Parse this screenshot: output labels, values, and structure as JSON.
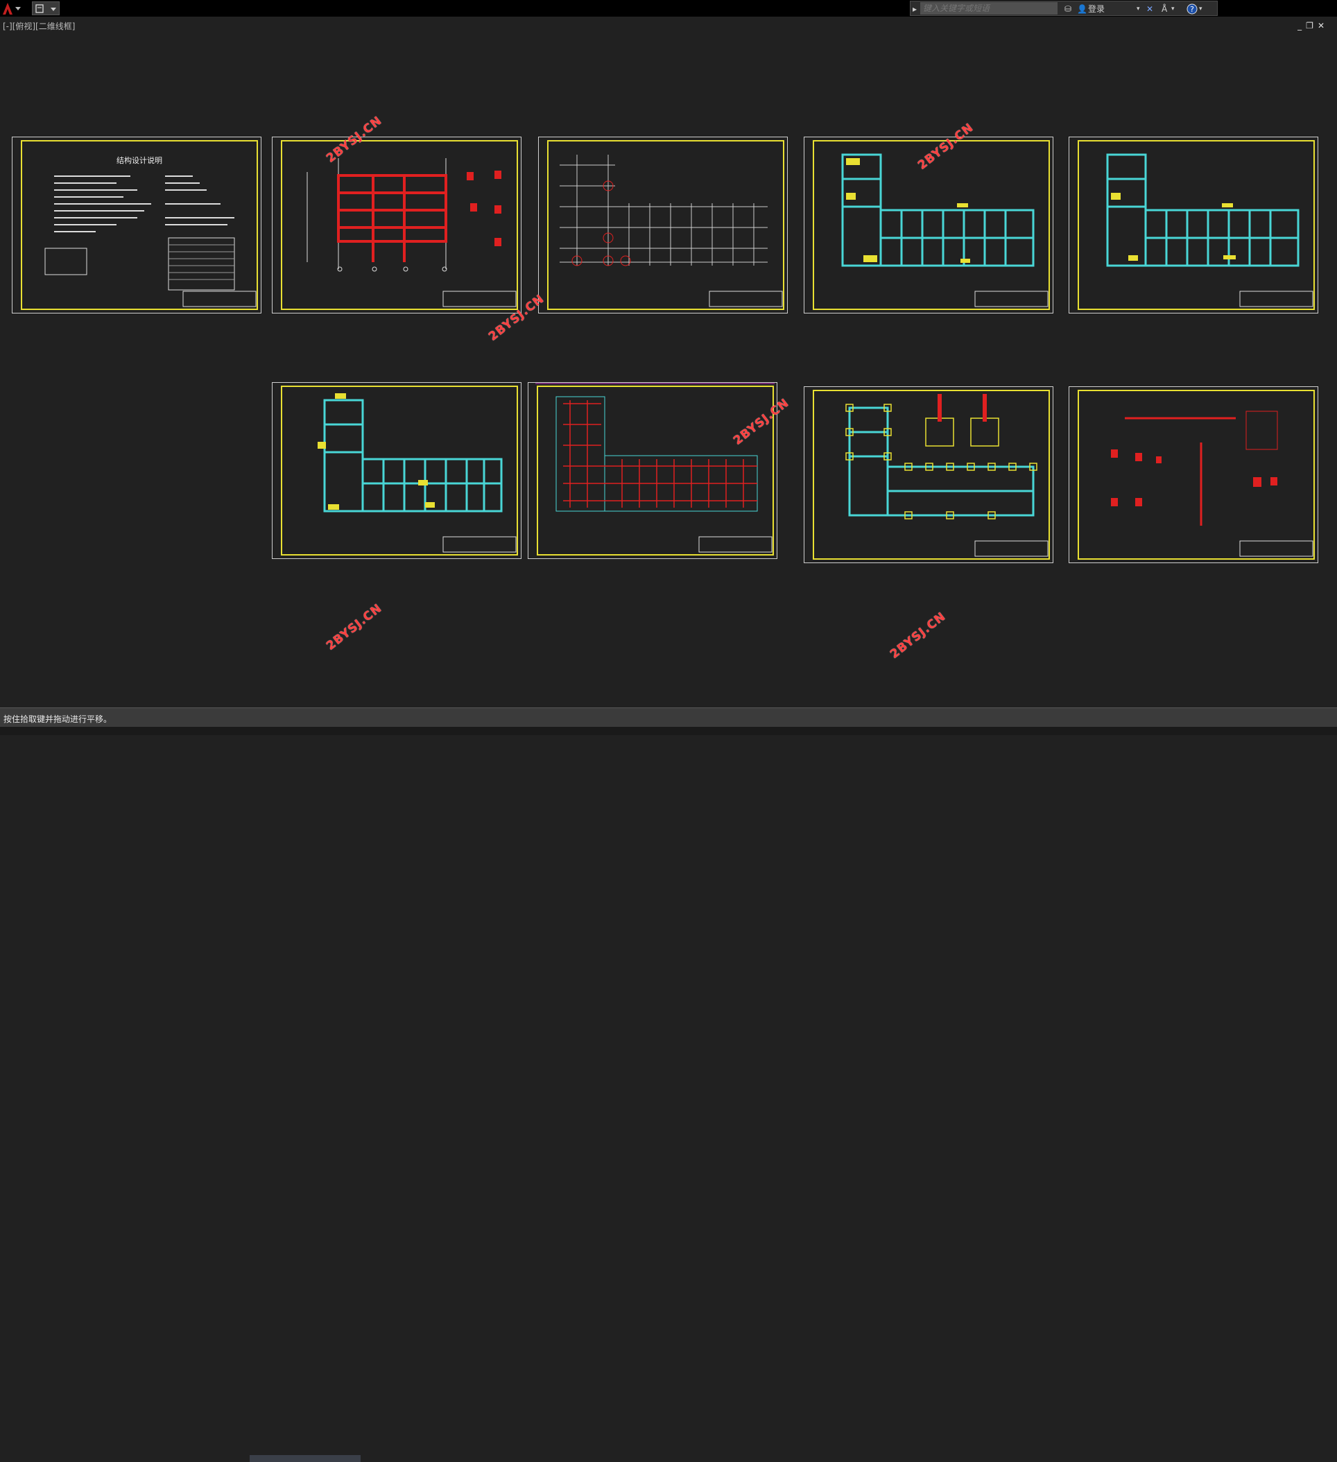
{
  "search": {
    "placeholder": "键入关键字或短语"
  },
  "user": {
    "login_label": "登录"
  },
  "viewport": {
    "label": "[-][俯视][二维线框]"
  },
  "window_controls": {
    "minimize": "_",
    "restore": "❐",
    "close": "✕"
  },
  "command": {
    "status_text": "按住拾取键并拖动进行平移。"
  },
  "sheets": [
    {
      "title": "结构设计说明",
      "type": "text"
    },
    {
      "type": "frame"
    },
    {
      "type": "grid"
    },
    {
      "type": "plan-l"
    },
    {
      "type": "plan-l"
    },
    {
      "type": "plan-l"
    },
    {
      "type": "plan-red"
    },
    {
      "type": "foundation"
    },
    {
      "type": "details"
    }
  ],
  "watermark": {
    "text": "2BYSJ.CN"
  },
  "colors": {
    "background": "#212121",
    "sheet_border": "#e9e032",
    "cyan": "#49d6d6",
    "red": "#e02020",
    "yellow": "#e9e032",
    "watermark": "#ff4040"
  }
}
